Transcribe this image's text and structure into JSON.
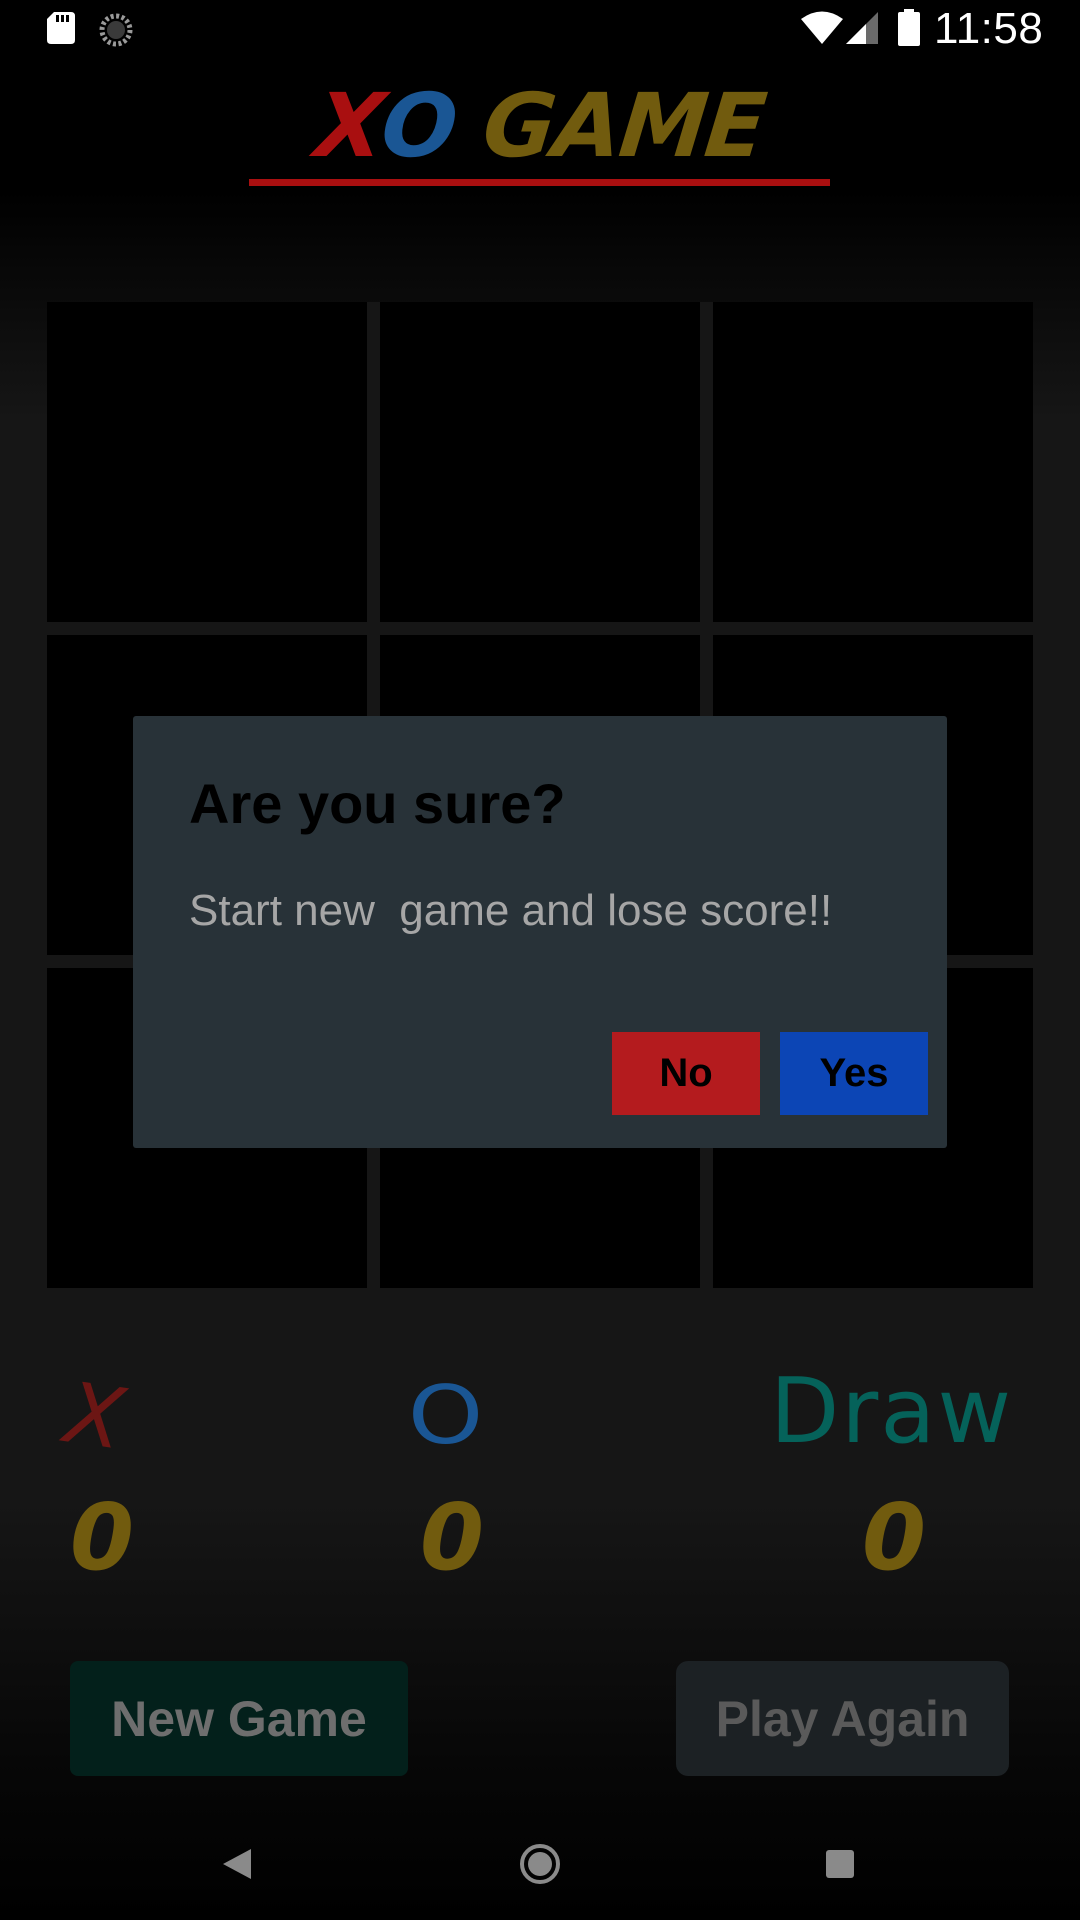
{
  "status_bar": {
    "time": "11:58",
    "icons": [
      "sd-card-icon",
      "sync-icon",
      "wifi-icon",
      "signal-icon",
      "battery-icon"
    ]
  },
  "app": {
    "title_x": "X",
    "title_o": "O",
    "title_rest": " GAME",
    "colors": {
      "x": "#a90f10",
      "o": "#1a5694",
      "game": "#715b0e",
      "underline": "#a90f10",
      "draw": "#05625a"
    }
  },
  "board": {
    "cells": [
      "",
      "",
      "",
      "",
      "",
      "",
      "",
      "",
      ""
    ]
  },
  "scores": {
    "x_label": "X",
    "o_label": "O",
    "draw_label": "Draw",
    "x_value": "0",
    "o_value": "0",
    "draw_value": "0"
  },
  "buttons": {
    "new_game": "New Game",
    "play_again": "Play Again"
  },
  "dialog": {
    "title": "Are you sure?",
    "message": "Start new  game and lose score!!",
    "no_label": "No",
    "yes_label": "Yes"
  },
  "nav": {
    "icons": [
      "back-icon",
      "home-icon",
      "recents-icon"
    ]
  }
}
